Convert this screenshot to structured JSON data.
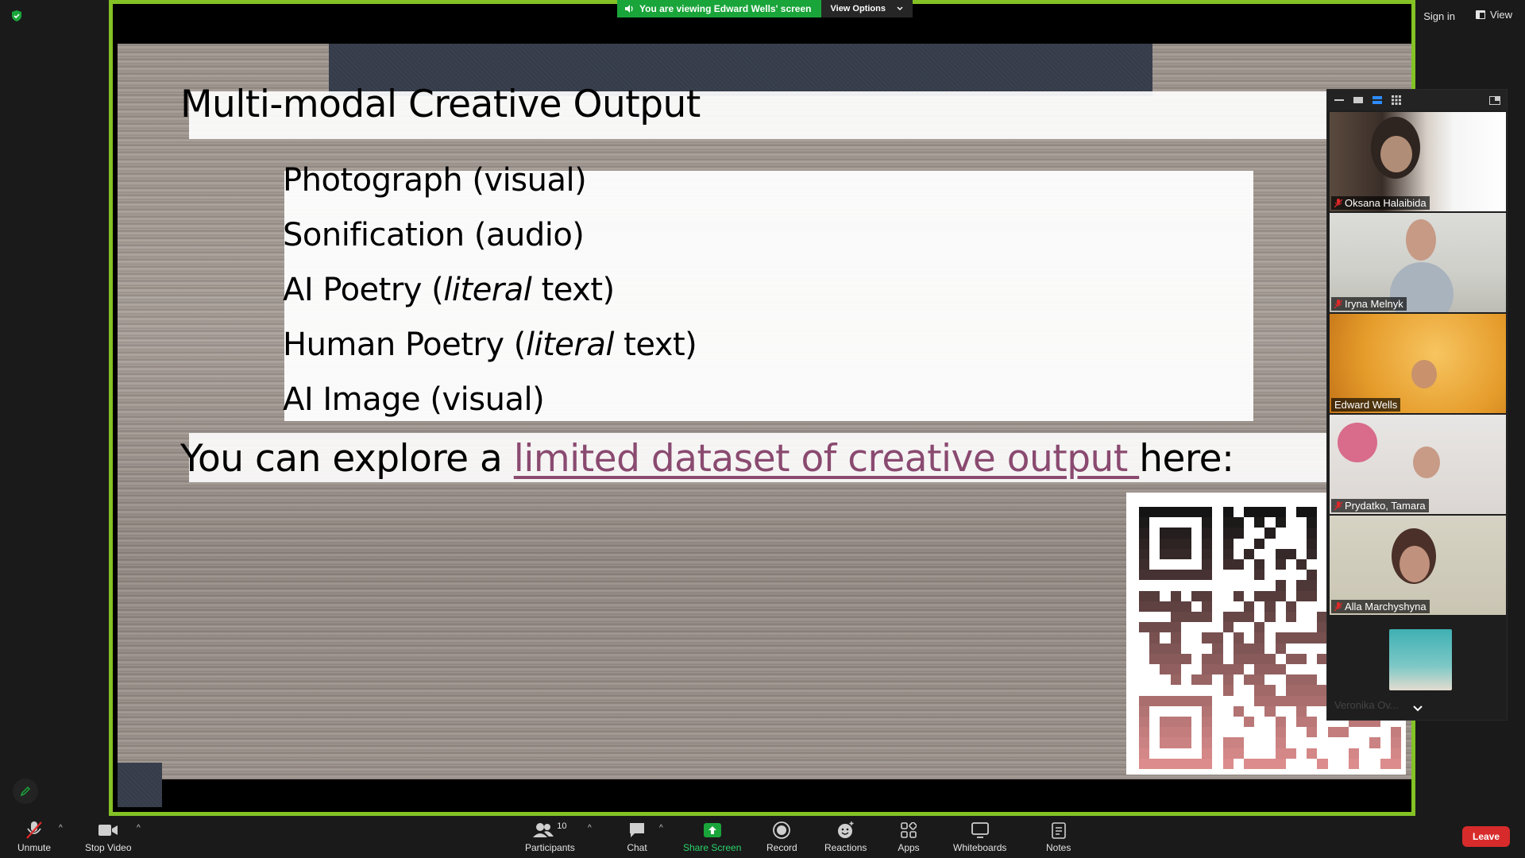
{
  "topbar": {
    "viewing_text": "You are viewing Edward Wells' screen",
    "view_options": "View Options",
    "sign_in": "Sign in",
    "view": "View"
  },
  "slide": {
    "title": "Multi-modal Creative Output",
    "items": [
      {
        "pre": "Photograph (visual)",
        "em": "",
        "post": ""
      },
      {
        "pre": "Sonification (audio)",
        "em": "",
        "post": ""
      },
      {
        "pre": "AI Poetry (",
        "em": "literal",
        "post": " text)"
      },
      {
        "pre": "Human Poetry (",
        "em": "literal",
        "post": " text)"
      },
      {
        "pre": "AI Image (visual)",
        "em": "",
        "post": ""
      }
    ],
    "explore_pre": "You can explore a ",
    "explore_link": "limited dataset of creative output ",
    "explore_post": "here:"
  },
  "participants": [
    {
      "name": "Oksana Halaibida",
      "muted": true
    },
    {
      "name": "Iryna Melnyk",
      "muted": true
    },
    {
      "name": "Edward Wells",
      "muted": false
    },
    {
      "name": "Prydatko, Tamara",
      "muted": true
    },
    {
      "name": "Alla Marchyshyna",
      "muted": true
    },
    {
      "name": "Veronika Ov...",
      "muted": true
    }
  ],
  "toolbar": {
    "unmute": "Unmute",
    "stop_video": "Stop Video",
    "participants": "Participants",
    "participants_count": "10",
    "chat": "Chat",
    "share_screen": "Share Screen",
    "record": "Record",
    "reactions": "Reactions",
    "apps": "Apps",
    "whiteboards": "Whiteboards",
    "notes": "Notes",
    "leave": "Leave"
  },
  "colors": {
    "share_border": "#84c225",
    "share_green": "#1aa53a",
    "leave_red": "#d72b2b",
    "link_color": "#8a4a70"
  }
}
